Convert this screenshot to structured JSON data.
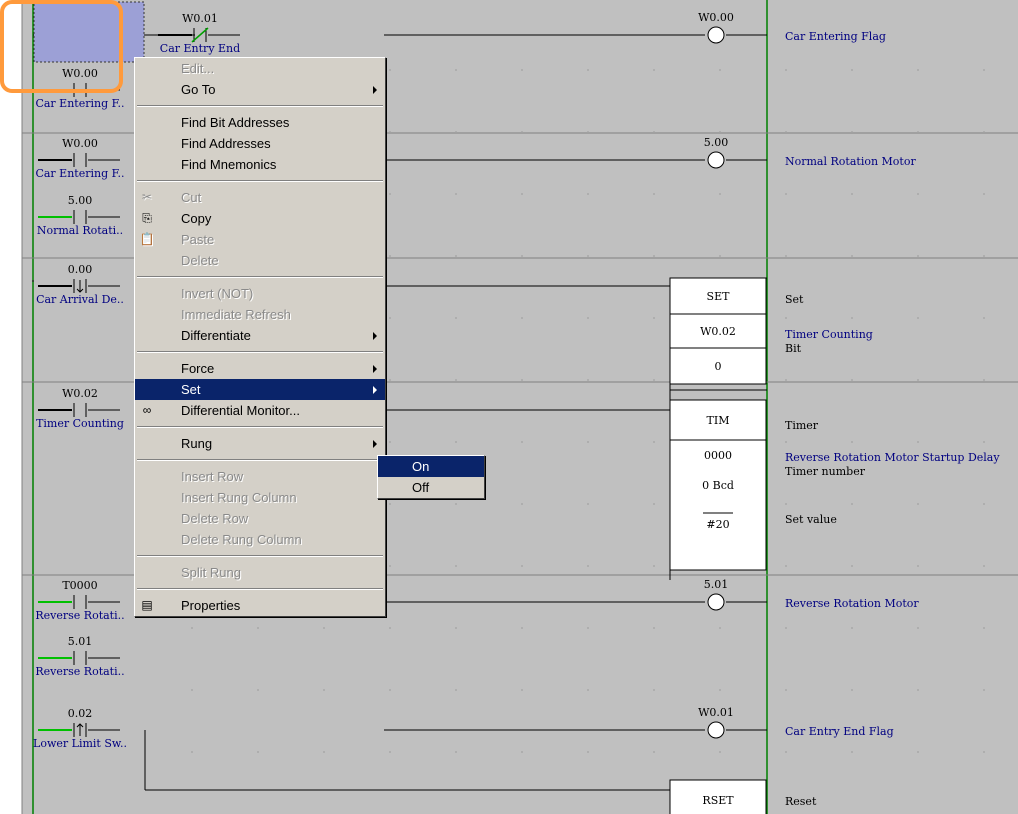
{
  "contacts": [
    {
      "addr": "0.00",
      "comment": "Car Arrival De..",
      "type": "no"
    },
    {
      "addr": "W0.01",
      "comment": "Car Entry End",
      "type": "nc"
    },
    {
      "addr": "W0.00",
      "comment": "Car Entering F..",
      "type": "no"
    },
    {
      "addr": "W0.00",
      "comment": "Car Entering F..",
      "type": "no"
    },
    {
      "addr": "5.00",
      "comment": "Normal Rotati..",
      "type": "no"
    },
    {
      "addr": "0.00",
      "comment": "Car Arrival De..",
      "type": "down"
    },
    {
      "addr": "W0.02",
      "comment": "Timer Counting",
      "type": "no"
    },
    {
      "addr": "T0000",
      "comment": "Reverse Rotati..",
      "type": "no"
    },
    {
      "addr": "5.01",
      "comment": "Reverse Rotati..",
      "type": "no"
    },
    {
      "addr": "0.02",
      "comment": "Lower Limit Sw..",
      "type": "up"
    }
  ],
  "coils": [
    {
      "addr": "W0.00",
      "comment": "Car Entering Flag"
    },
    {
      "addr": "5.00",
      "comment": "Normal Rotation Motor"
    },
    {
      "addr": "5.01",
      "comment": "Reverse Rotation Motor"
    },
    {
      "addr": "W0.01",
      "comment": "Car Entry End Flag"
    }
  ],
  "boxes": {
    "set": {
      "instr": "SET",
      "operand": "W0.02",
      "extra": "0",
      "c1": "Set",
      "c2": "Timer Counting",
      "c3": "Bit"
    },
    "tim": {
      "instr": "TIM",
      "operand": "0000",
      "bcd": "0 Bcd",
      "sv": "#20",
      "c1": "Timer",
      "c2": "Reverse Rotation Motor Startup Delay",
      "c3": "Timer number",
      "c4": "Set value"
    },
    "rset": {
      "instr": "RSET",
      "c1": "Reset"
    }
  },
  "menu": [
    {
      "label": "Edit...",
      "disabled": true
    },
    {
      "label": "Go To",
      "arrow": true
    },
    {
      "sep": true
    },
    {
      "label": "Find Bit Addresses"
    },
    {
      "label": "Find Addresses"
    },
    {
      "label": "Find Mnemonics"
    },
    {
      "sep": true
    },
    {
      "label": "Cut",
      "disabled": true,
      "icon": "scissors-icon",
      "glyph": "✂"
    },
    {
      "label": "Copy",
      "icon": "copy-icon",
      "glyph": "⎘"
    },
    {
      "label": "Paste",
      "disabled": true,
      "icon": "paste-icon",
      "glyph": "📋"
    },
    {
      "label": "Delete",
      "disabled": true
    },
    {
      "sep": true
    },
    {
      "label": "Invert (NOT)",
      "disabled": true
    },
    {
      "label": "Immediate Refresh",
      "disabled": true
    },
    {
      "label": "Differentiate",
      "arrow": true
    },
    {
      "sep": true
    },
    {
      "label": "Force",
      "arrow": true
    },
    {
      "label": "Set",
      "arrow": true,
      "highlight": true
    },
    {
      "label": "Differential Monitor...",
      "icon": "differential-monitor-icon",
      "glyph": "∞"
    },
    {
      "sep": true
    },
    {
      "label": "Rung",
      "arrow": true
    },
    {
      "sep": true
    },
    {
      "label": "Insert Row",
      "disabled": true
    },
    {
      "label": "Insert Rung Column",
      "disabled": true
    },
    {
      "label": "Delete Row",
      "disabled": true
    },
    {
      "label": "Delete Rung Column",
      "disabled": true
    },
    {
      "sep": true
    },
    {
      "label": "Split Rung",
      "disabled": true
    },
    {
      "sep": true
    },
    {
      "label": "Properties",
      "icon": "properties-icon",
      "glyph": "▤"
    }
  ],
  "submenu": [
    {
      "label": "On",
      "highlight": true
    },
    {
      "label": "Off"
    }
  ],
  "colors": {
    "accent": "#0a246a",
    "rail": "#008000",
    "highlight": "#ff9a3c",
    "contactOn": "#00c000"
  }
}
